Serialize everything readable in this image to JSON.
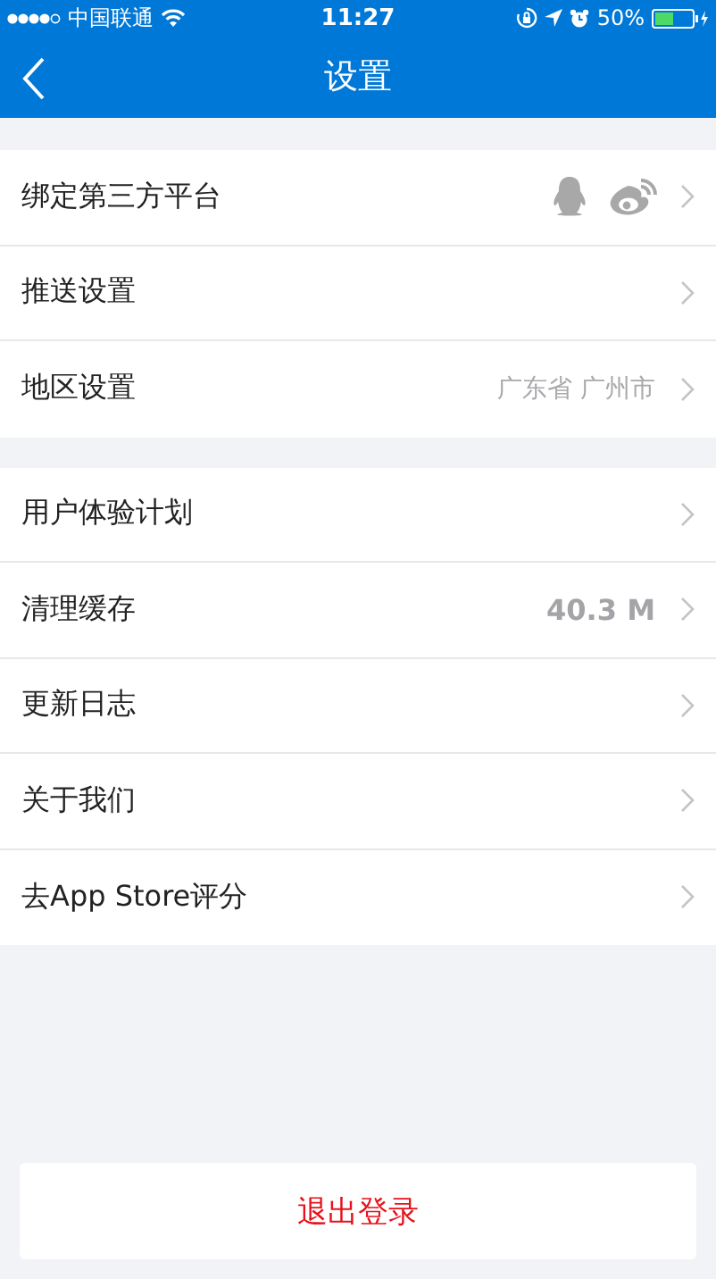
{
  "status_bar": {
    "carrier": "中国联通",
    "time": "11:27",
    "battery": "50%"
  },
  "nav": {
    "title": "设置"
  },
  "groups": [
    {
      "rows": [
        {
          "label": "绑定第三方平台",
          "kind": "icons"
        },
        {
          "label": "推送设置",
          "kind": "plain"
        },
        {
          "label": "地区设置",
          "kind": "value",
          "value": "广东省 广州市",
          "bold": false
        }
      ]
    },
    {
      "rows": [
        {
          "label": "用户体验计划",
          "kind": "plain"
        },
        {
          "label": "清理缓存",
          "kind": "value",
          "value": "40.3 M",
          "bold": true
        },
        {
          "label": "更新日志",
          "kind": "plain"
        },
        {
          "label": "关于我们",
          "kind": "plain"
        },
        {
          "label": "去App Store评分",
          "kind": "plain"
        }
      ]
    }
  ],
  "logout": "退出登录"
}
